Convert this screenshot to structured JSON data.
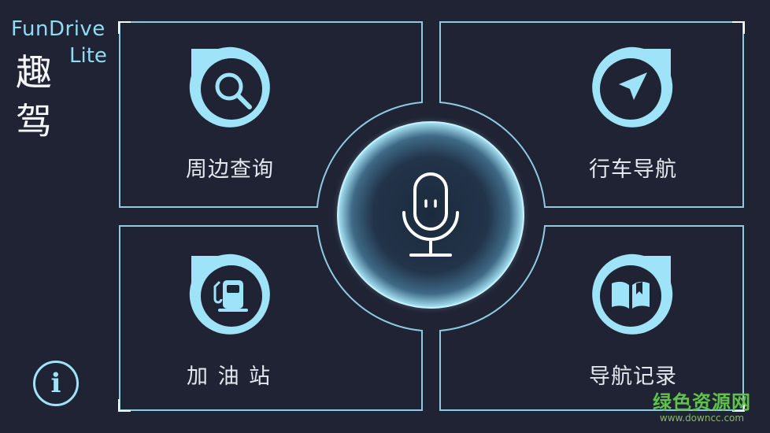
{
  "brand": {
    "name_en_1": "FunDrive",
    "name_en_2": "Lite",
    "name_zh_1": "趣",
    "name_zh_2": "驾"
  },
  "tiles": {
    "nearby_search": {
      "label": "周边查询",
      "icon": "search-icon"
    },
    "navigation": {
      "label": "行车导航",
      "icon": "navigation-arrow-icon"
    },
    "gas_station": {
      "label": "加 油 站",
      "icon": "fuel-pump-icon"
    },
    "nav_history": {
      "label": "导航记录",
      "icon": "book-icon"
    }
  },
  "center": {
    "icon": "microphone-icon"
  },
  "info": {
    "label": "i",
    "icon": "info-icon"
  },
  "watermark": {
    "line1": "绿色资源网",
    "line2": "www.downcc.com"
  },
  "colors": {
    "background": "#1f2334",
    "accent": "#9fe3f8",
    "panel_stroke": "#8fcbe0"
  }
}
